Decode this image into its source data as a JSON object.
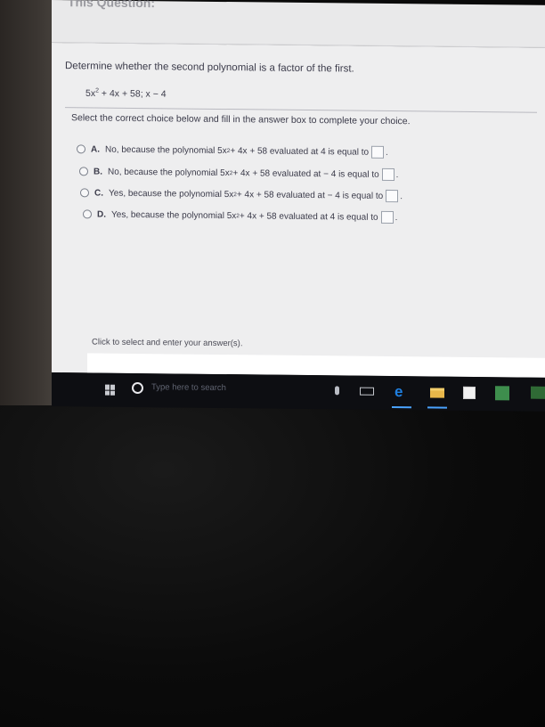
{
  "header": {
    "title_fragment": "This Question:"
  },
  "question": {
    "prompt": "Determine whether the second polynomial is a factor of the first.",
    "poly_base": "5x",
    "poly_exp": "2",
    "poly_rest": " + 4x + 58; x − 4",
    "instruction": "Select the correct choice below and fill in the answer box to complete your choice."
  },
  "choices": [
    {
      "letter": "A.",
      "pre": "No, because the polynomial 5x",
      "exp": "2",
      "post": " + 4x + 58 evaluated at 4 is equal to"
    },
    {
      "letter": "B.",
      "pre": "No, because the polynomial 5x",
      "exp": "2",
      "post": " + 4x + 58 evaluated at  − 4 is equal to"
    },
    {
      "letter": "C.",
      "pre": "Yes, because the polynomial 5x",
      "exp": "2",
      "post": " + 4x + 58 evaluated at  − 4 is equal to"
    },
    {
      "letter": "D.",
      "pre": "Yes, because the polynomial 5x",
      "exp": "2",
      "post": " + 4x + 58 evaluated at 4 is equal to"
    }
  ],
  "footer": {
    "hint": "Click to select and enter your answer(s)."
  },
  "taskbar": {
    "search_placeholder": "Type here to search",
    "icons": [
      "windows-start-icon",
      "cortana-icon",
      "microphone-icon",
      "task-view-icon",
      "edge-icon",
      "file-explorer-icon",
      "store-icon",
      "app-icon",
      "app-icon-2"
    ]
  },
  "colors": {
    "edge_blue": "#1f7fe0",
    "folder_yellow": "#e8b74a",
    "taskbar": "#0d0e12"
  }
}
